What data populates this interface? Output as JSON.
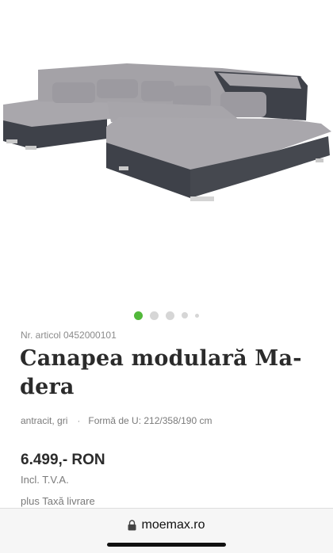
{
  "product": {
    "article_number": "Nr. articol 0452000101",
    "title_bold": "Canapea",
    "title_rest": " modulară Ma-\ndera",
    "color": "antracit, gri",
    "separator": "·",
    "shape": "Formă de U: 212/358/190 cm",
    "price": "6.499,- RON",
    "vat_note": "Incl. T.V.A.",
    "delivery_note": "plus Taxă livrare"
  },
  "gallery": {
    "active_index": 0,
    "dot_count": 5,
    "active_color": "#52b83a",
    "inactive_color": "#d6d6d6"
  },
  "browser": {
    "url": "moemax.ro",
    "icon": "lock-icon"
  },
  "colors": {
    "upholstery_light": "#a8a6ab",
    "upholstery_dark": "#3e4149"
  }
}
